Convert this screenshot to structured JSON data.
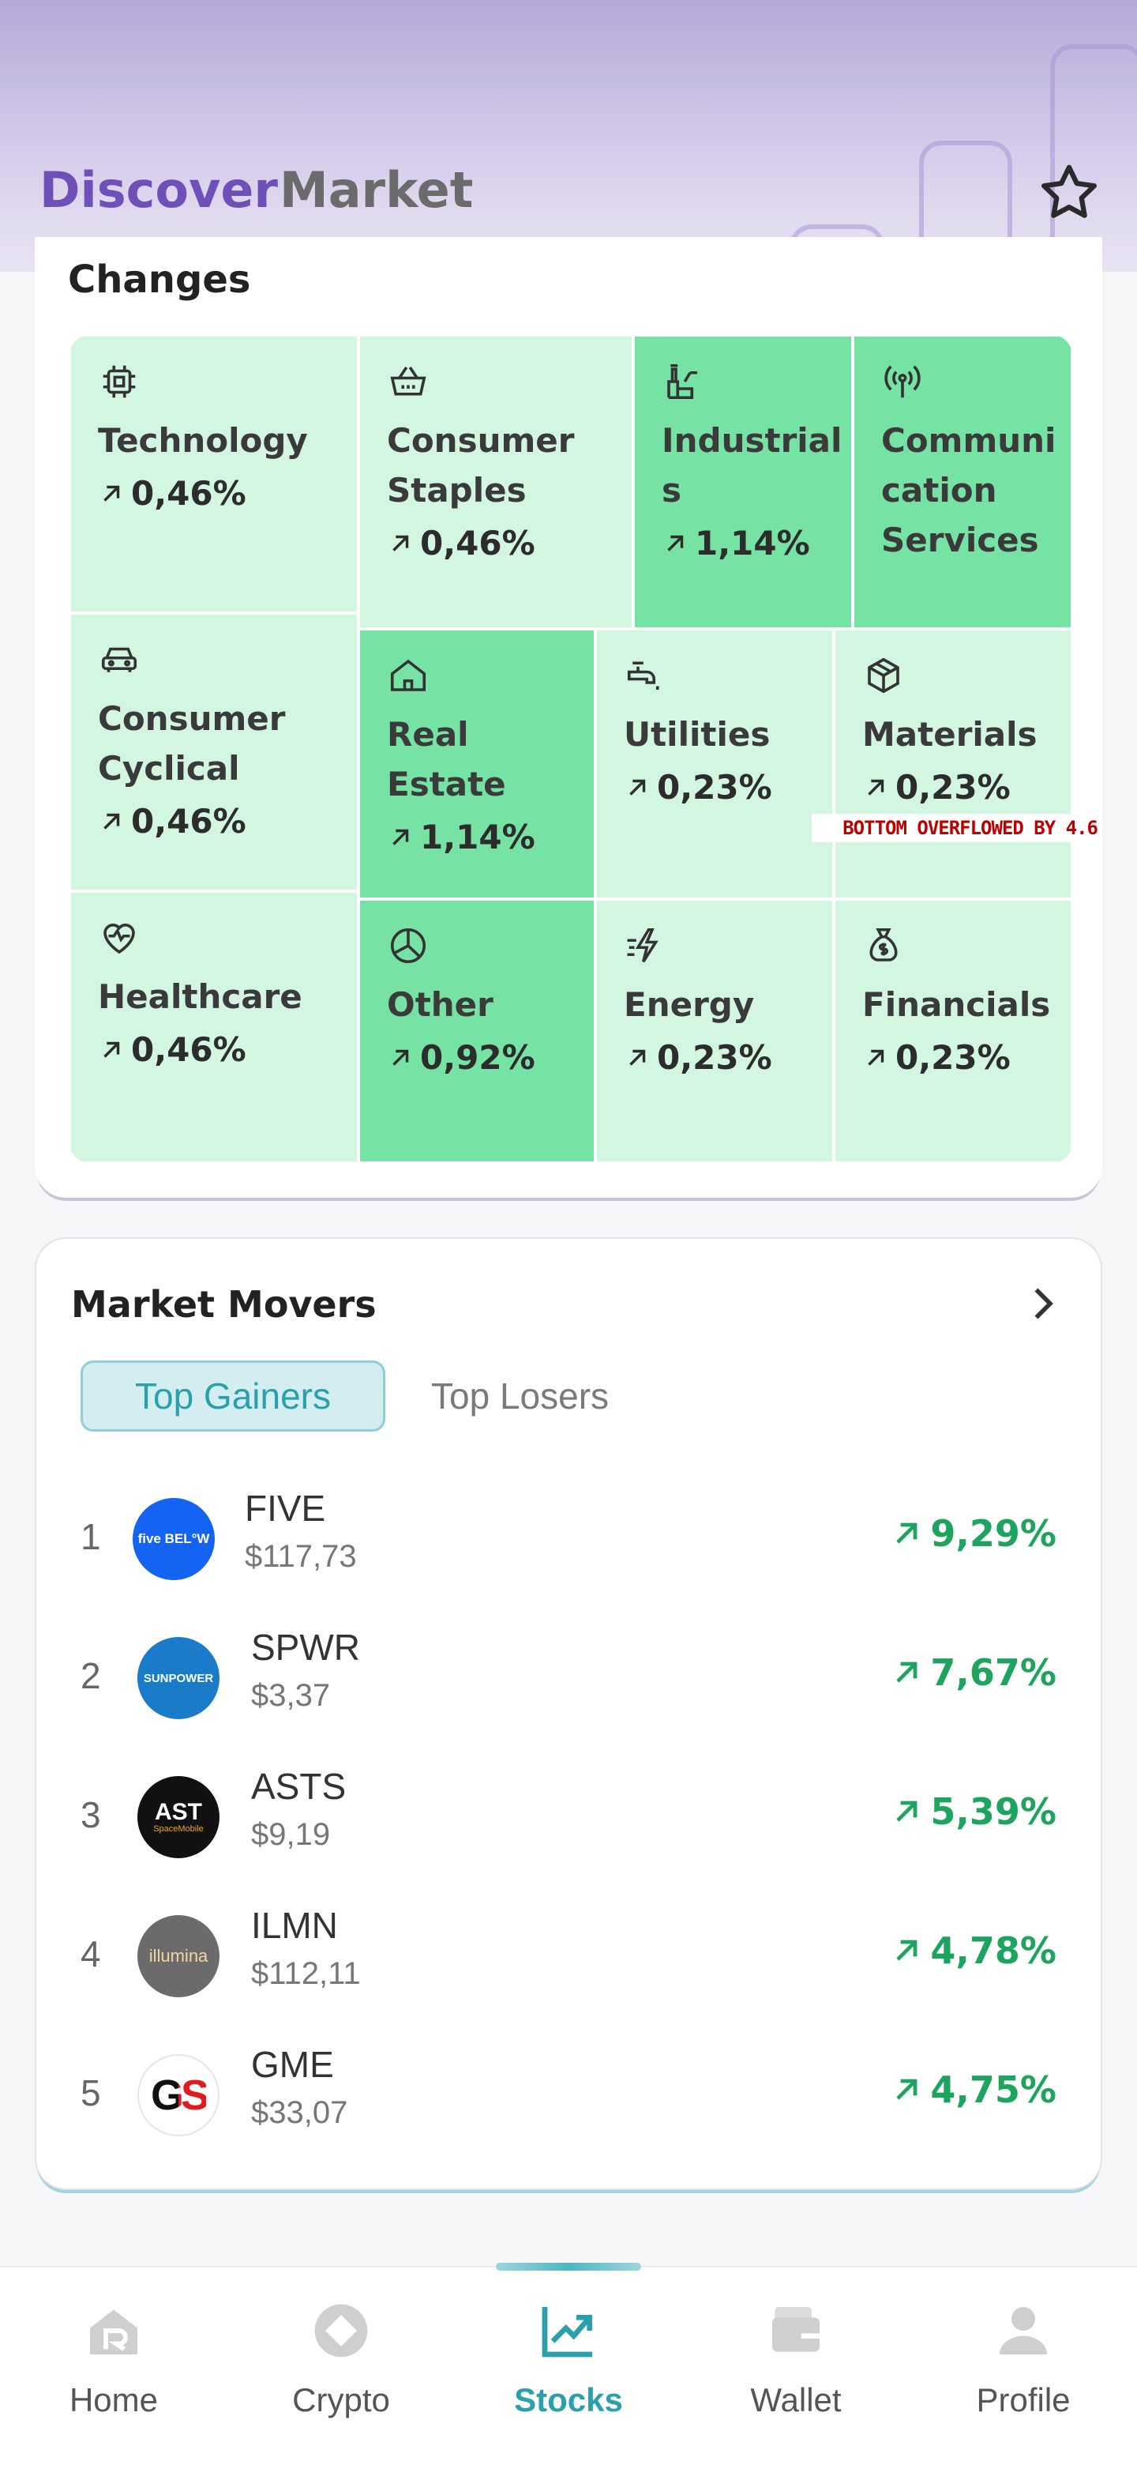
{
  "header": {
    "tab_discover": "Discover",
    "tab_market": "Market",
    "star_icon": "star-icon"
  },
  "sectors": {
    "heading": "Changes",
    "overflow_warning": "BOTTOM OVERFLOWED BY 4.6",
    "cells": [
      {
        "name": "Technology",
        "change": "0,46%",
        "icon": "chip-icon",
        "shade": "light"
      },
      {
        "name": "Consumer Staples",
        "change": "0,46%",
        "icon": "basket-icon",
        "shade": "light"
      },
      {
        "name": "Industrials",
        "change": "1,14%",
        "icon": "industrial-icon",
        "shade": "dark"
      },
      {
        "name": "Communication Services",
        "change": "",
        "icon": "antenna-icon",
        "shade": "dark"
      },
      {
        "name": "Consumer Cyclical",
        "change": "0,46%",
        "icon": "car-icon",
        "shade": "light"
      },
      {
        "name": "Real Estate",
        "change": "1,14%",
        "icon": "home-icon",
        "shade": "dark"
      },
      {
        "name": "Utilities",
        "change": "0,23%",
        "icon": "faucet-icon",
        "shade": "light"
      },
      {
        "name": "Materials",
        "change": "0,23%",
        "icon": "box-icon",
        "shade": "light"
      },
      {
        "name": "Healthcare",
        "change": "0,46%",
        "icon": "heart-pulse-icon",
        "shade": "light"
      },
      {
        "name": "Other",
        "change": "0,92%",
        "icon": "pie-icon",
        "shade": "dark"
      },
      {
        "name": "Energy",
        "change": "0,23%",
        "icon": "bolt-icon",
        "shade": "light"
      },
      {
        "name": "Financials",
        "change": "0,23%",
        "icon": "money-bag-icon",
        "shade": "light"
      }
    ],
    "labels": {
      "technology": "Technology",
      "consumer_staples_1": "Consumer",
      "consumer_staples_2": "Staples",
      "industrials_1": "Industrial",
      "industrials_2": "s",
      "communication_1": "Communi",
      "communication_2": "cation",
      "communication_3": "Services",
      "consumer_cyclical_1": "Consumer",
      "consumer_cyclical_2": "Cyclical",
      "real_estate_1": "Real",
      "real_estate_2": "Estate",
      "utilities": "Utilities",
      "materials": "Materials",
      "healthcare": "Healthcare",
      "other": "Other",
      "energy": "Energy",
      "financials": "Financials"
    },
    "changes": {
      "technology": "0,46%",
      "consumer_staples": "0,46%",
      "industrials": "1,14%",
      "consumer_cyclical": "0,46%",
      "real_estate": "1,14%",
      "utilities": "0,23%",
      "materials": "0,23%",
      "healthcare": "0,46%",
      "other": "0,92%",
      "energy": "0,23%",
      "financials": "0,23%"
    }
  },
  "movers": {
    "title": "Market Movers",
    "tab_gainers": "Top Gainers",
    "tab_losers": "Top Losers",
    "rows": [
      {
        "rank": "1",
        "ticker": "FIVE",
        "price": "$117,73",
        "change": "9,29%",
        "logo_text": "five BEL°W",
        "logo_bg": "#1463f3"
      },
      {
        "rank": "2",
        "ticker": "SPWR",
        "price": "$3,37",
        "change": "7,67%",
        "logo_text": "SUNPOWER",
        "logo_bg": "#1a7cc8"
      },
      {
        "rank": "3",
        "ticker": "ASTS",
        "price": "$9,19",
        "change": "5,39%",
        "logo_text": "AST",
        "logo_sub": "SpaceMobile",
        "logo_bg": "#111111"
      },
      {
        "rank": "4",
        "ticker": "ILMN",
        "price": "$112,11",
        "change": "4,78%",
        "logo_text": "illumina",
        "logo_bg": "#6b6b6b"
      },
      {
        "rank": "5",
        "ticker": "GME",
        "price": "$33,07",
        "change": "4,75%",
        "logo_text": "GS",
        "logo_bg": "#ffffff"
      }
    ]
  },
  "bottom_nav": {
    "home": "Home",
    "crypto": "Crypto",
    "stocks": "Stocks",
    "wallet": "Wallet",
    "profile": "Profile",
    "active": "Stocks",
    "accent": "#2aa0ad"
  },
  "colors": {
    "brand_purple": "#6f4fb8",
    "cell_light": "#d3f6e0",
    "cell_dark": "#76e2a4",
    "gain_green": "#1ea55d"
  }
}
